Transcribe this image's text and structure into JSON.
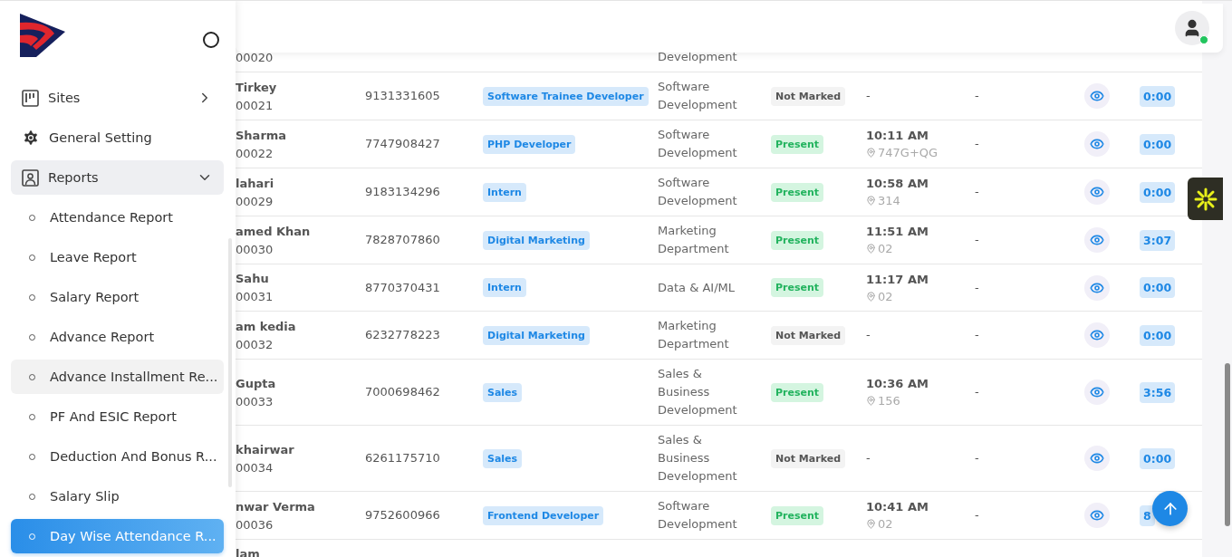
{
  "sidebar": {
    "items": [
      {
        "label": "Sites",
        "kind": "group",
        "expanded": false
      },
      {
        "label": "General Setting",
        "kind": "link"
      },
      {
        "label": "Reports",
        "kind": "group",
        "expanded": true,
        "children": [
          {
            "label": "Attendance Report",
            "selected": false,
            "hovered": false
          },
          {
            "label": "Leave Report",
            "selected": false,
            "hovered": false
          },
          {
            "label": "Salary Report",
            "selected": false,
            "hovered": false
          },
          {
            "label": "Advance Report",
            "selected": false,
            "hovered": false
          },
          {
            "label": "Advance Installment Re...",
            "selected": false,
            "hovered": true
          },
          {
            "label": "PF And ESIC Report",
            "selected": false,
            "hovered": false
          },
          {
            "label": "Deduction And Bonus R...",
            "selected": false,
            "hovered": false
          },
          {
            "label": "Salary Slip",
            "selected": false,
            "hovered": false
          },
          {
            "label": "Day Wise Attendance R...",
            "selected": true,
            "hovered": false
          }
        ]
      }
    ]
  },
  "header": {
    "user_online": true
  },
  "table": {
    "rows": [
      {
        "kind": "partial_top",
        "id": "00020",
        "department": "Development"
      },
      {
        "kind": "full",
        "name": "Tirkey",
        "id": "00021",
        "phone": "9131331605",
        "designation": "Software Trainee Developer",
        "department": "Software Development",
        "status": {
          "label": "Not Marked",
          "kind": "not_marked"
        },
        "in_time": "-",
        "out_time": "-",
        "hours": "0:00"
      },
      {
        "kind": "full",
        "name": "Sharma",
        "id": "00022",
        "phone": "7747908427",
        "designation": "PHP Developer",
        "department": "Software Development",
        "status": {
          "label": "Present",
          "kind": "present"
        },
        "in_time": "10:11 AM",
        "in_location": "747G+QG",
        "out_time": "-",
        "hours": "0:00"
      },
      {
        "kind": "full",
        "name": "lahari",
        "id": "00029",
        "phone": "9183134296",
        "designation": "Intern",
        "department": "Software Development",
        "status": {
          "label": "Present",
          "kind": "present"
        },
        "in_time": "10:58 AM",
        "in_location": "314",
        "out_time": "-",
        "hours": "0:00"
      },
      {
        "kind": "full",
        "name": "amed Khan",
        "id": "00030",
        "phone": "7828707860",
        "designation": "Digital Marketing",
        "department": "Marketing Department",
        "status": {
          "label": "Present",
          "kind": "present"
        },
        "in_time": "11:51 AM",
        "in_location": "02",
        "out_time": "-",
        "hours": "3:07"
      },
      {
        "kind": "full",
        "name": "Sahu",
        "id": "00031",
        "phone": "8770370431",
        "designation": "Intern",
        "department": "Data & AI/ML",
        "status": {
          "label": "Present",
          "kind": "present"
        },
        "in_time": "11:17 AM",
        "in_location": "02",
        "out_time": "-",
        "hours": "0:00"
      },
      {
        "kind": "full",
        "name": "am kedia",
        "id": "00032",
        "phone": "6232778223",
        "designation": "Digital Marketing",
        "department": "Marketing Department",
        "status": {
          "label": "Not Marked",
          "kind": "not_marked"
        },
        "in_time": "-",
        "out_time": "-",
        "hours": "0:00"
      },
      {
        "kind": "full",
        "name": "Gupta",
        "id": "00033",
        "phone": "7000698462",
        "designation": "Sales",
        "department": "Sales & Business Development",
        "status": {
          "label": "Present",
          "kind": "present"
        },
        "in_time": "10:36 AM",
        "in_location": "156",
        "out_time": "-",
        "hours": "3:56"
      },
      {
        "kind": "full",
        "name": "khairwar",
        "id": "00034",
        "phone": "6261175710",
        "designation": "Sales",
        "department": "Sales & Business Development",
        "status": {
          "label": "Not Marked",
          "kind": "not_marked"
        },
        "in_time": "-",
        "out_time": "-",
        "hours": "0:00"
      },
      {
        "kind": "full",
        "name": "nwar Verma",
        "id": "00036",
        "phone": "9752600966",
        "designation": "Frontend Developer",
        "department": "Software Development",
        "status": {
          "label": "Present",
          "kind": "present"
        },
        "in_time": "10:41 AM",
        "in_location": "02",
        "out_time": "-",
        "hours": "8"
      },
      {
        "kind": "partial_bottom",
        "name": "lam"
      }
    ]
  }
}
